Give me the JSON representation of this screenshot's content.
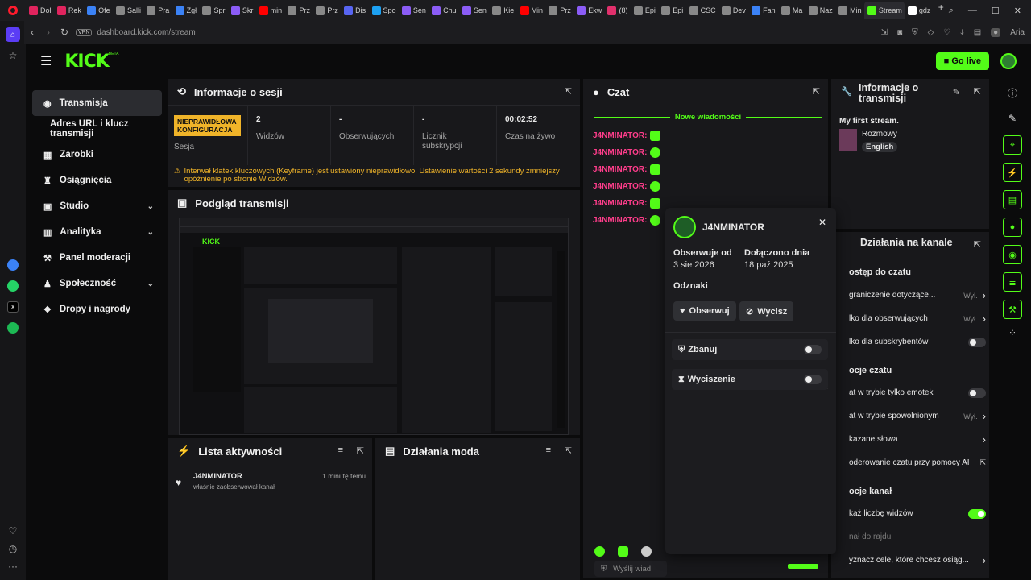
{
  "browser": {
    "tabs": [
      {
        "label": "Dol",
        "color": "#e0245e"
      },
      {
        "label": "Rek",
        "color": "#e0245e"
      },
      {
        "label": "Ofe",
        "color": "#3b82f6"
      },
      {
        "label": "Salli",
        "color": "#888888"
      },
      {
        "label": "Pra",
        "color": "#888888"
      },
      {
        "label": "Zgł",
        "color": "#3b82f6"
      },
      {
        "label": "Spr",
        "color": "#888888"
      },
      {
        "label": "Skr",
        "color": "#8b5cf6"
      },
      {
        "label": "min",
        "color": "#ff0000"
      },
      {
        "label": "Prz",
        "color": "#888888"
      },
      {
        "label": "Prz",
        "color": "#888888"
      },
      {
        "label": "Dis",
        "color": "#5865f2"
      },
      {
        "label": "Spo",
        "color": "#1da1f2"
      },
      {
        "label": "Sen",
        "color": "#8b5cf6"
      },
      {
        "label": "Chu",
        "color": "#8b5cf6"
      },
      {
        "label": "Sen",
        "color": "#8b5cf6"
      },
      {
        "label": "Kie",
        "color": "#888888"
      },
      {
        "label": "Min",
        "color": "#ff0000"
      },
      {
        "label": "Prz",
        "color": "#888888"
      },
      {
        "label": "Ekw",
        "color": "#8b5cf6"
      },
      {
        "label": "(8)",
        "color": "#e1306c"
      },
      {
        "label": "Epi",
        "color": "#888888"
      },
      {
        "label": "Epi",
        "color": "#888888"
      },
      {
        "label": "CSC",
        "color": "#888888"
      },
      {
        "label": "Dev",
        "color": "#888888"
      },
      {
        "label": "Fan",
        "color": "#3b82f6"
      },
      {
        "label": "Ma",
        "color": "#888888"
      },
      {
        "label": "Naz",
        "color": "#888888"
      },
      {
        "label": "Min",
        "color": "#888888"
      },
      {
        "label": "Stream",
        "color": "#53fc18"
      },
      {
        "label": "gdz",
        "color": "#ffffff"
      }
    ],
    "active_tab_index": 29,
    "url": "dashboard.kick.com/stream",
    "vpn_label": "VPN"
  },
  "topnav": {
    "logo": "KICK",
    "beta": "BETA",
    "go_live": "Go live"
  },
  "sidebar": {
    "items": [
      {
        "label": "Transmisja",
        "icon": "broadcast-icon",
        "active": true,
        "chevron": false
      },
      {
        "label": "Adres URL i klucz transmisji",
        "icon": "",
        "active": false,
        "chevron": false
      },
      {
        "label": "Zarobki",
        "icon": "earnings-icon",
        "active": false,
        "chevron": false
      },
      {
        "label": "Osiągnięcia",
        "icon": "trophy-icon",
        "active": false,
        "chevron": false
      },
      {
        "label": "Studio",
        "icon": "studio-icon",
        "active": false,
        "chevron": true
      },
      {
        "label": "Analityka",
        "icon": "chart-icon",
        "active": false,
        "chevron": true
      },
      {
        "label": "Panel moderacji",
        "icon": "wrench-icon",
        "active": false,
        "chevron": false
      },
      {
        "label": "Społeczność",
        "icon": "community-icon",
        "active": false,
        "chevron": true
      },
      {
        "label": "Dropy i nagrody",
        "icon": "gift-icon",
        "active": false,
        "chevron": false
      }
    ]
  },
  "session": {
    "title": "Informacje o sesji",
    "badge": "NIEPRAWIDŁOWA KONFIGURACJA",
    "session_label": "Sesja",
    "stats": [
      {
        "value": "2",
        "label": "Widzów"
      },
      {
        "value": "-",
        "label": "Obserwujących"
      },
      {
        "value": "-",
        "label": "Licznik subskrypcji"
      },
      {
        "value": "00:02:52",
        "label": "Czas na żywo"
      }
    ],
    "warning": "Interwał klatek kluczowych (Keyframe) jest ustawiony nieprawidłowo. Ustawienie wartości 2 sekundy zmniejszy opóźnienie po stronie Widzów."
  },
  "preview": {
    "title": "Podgląd transmisji"
  },
  "activity": {
    "title": "Lista aktywności",
    "items": [
      {
        "user": "J4NMINATOR",
        "text": "właśnie zaobserwował kanał",
        "time": "1 minutę temu"
      }
    ]
  },
  "modactions": {
    "title": "Działania moda"
  },
  "chat": {
    "title": "Czat",
    "new_messages": "Nowe wiadomości",
    "messages": [
      "J4NMINATOR:",
      "J4NMINATOR:",
      "J4NMINATOR:",
      "J4NMINATOR:",
      "J4NMINATOR:",
      "J4NMINATOR:"
    ],
    "input_placeholder": "Wyślij wiad"
  },
  "usercard": {
    "username": "J4NMINATOR",
    "follows_since_label": "Obserwuje od",
    "follows_since": "3 sie 2026",
    "joined_label": "Dołączono dnia",
    "joined": "18 paź 2025",
    "badges_label": "Odznaki",
    "follow": "Obserwuj",
    "mute": "Wycisz",
    "ban": "Zbanuj",
    "timeout": "Wyciszenie"
  },
  "streaminfo": {
    "title": "Informacje o transmisji",
    "stream_title": "My first stream.",
    "category": "Rozmowy",
    "language": "English"
  },
  "channelactions": {
    "title": "Działania na kanale",
    "rows": [
      {
        "text": "ostęp do czatu",
        "value": "",
        "control": "heading"
      },
      {
        "text": "graniczenie dotyczące...",
        "value": "Wył.",
        "control": "arrow"
      },
      {
        "text": "lko dla obserwujących",
        "value": "Wył.",
        "control": "arrow"
      },
      {
        "text": "lko dla subskrybentów",
        "value": "",
        "control": "toggle-off"
      },
      {
        "text": "ocje czatu",
        "value": "",
        "control": "heading"
      },
      {
        "text": "at w trybie tylko emotek",
        "value": "",
        "control": "toggle-off"
      },
      {
        "text": "at w trybie spowolnionym",
        "value": "Wył.",
        "control": "arrow"
      },
      {
        "text": "kazane słowa",
        "value": "",
        "control": "arrow"
      },
      {
        "text": "oderowanie czatu przy pomocy AI",
        "value": "",
        "control": "external"
      },
      {
        "text": "ocje kanał",
        "value": "",
        "control": "heading"
      },
      {
        "text": "każ liczbę widzów",
        "value": "",
        "control": "toggle-on"
      },
      {
        "text": "nał do rajdu",
        "value": "",
        "control": "none"
      },
      {
        "text": "yznacz cele, które chcesz osiąg...",
        "value": "",
        "control": "arrow"
      }
    ]
  }
}
